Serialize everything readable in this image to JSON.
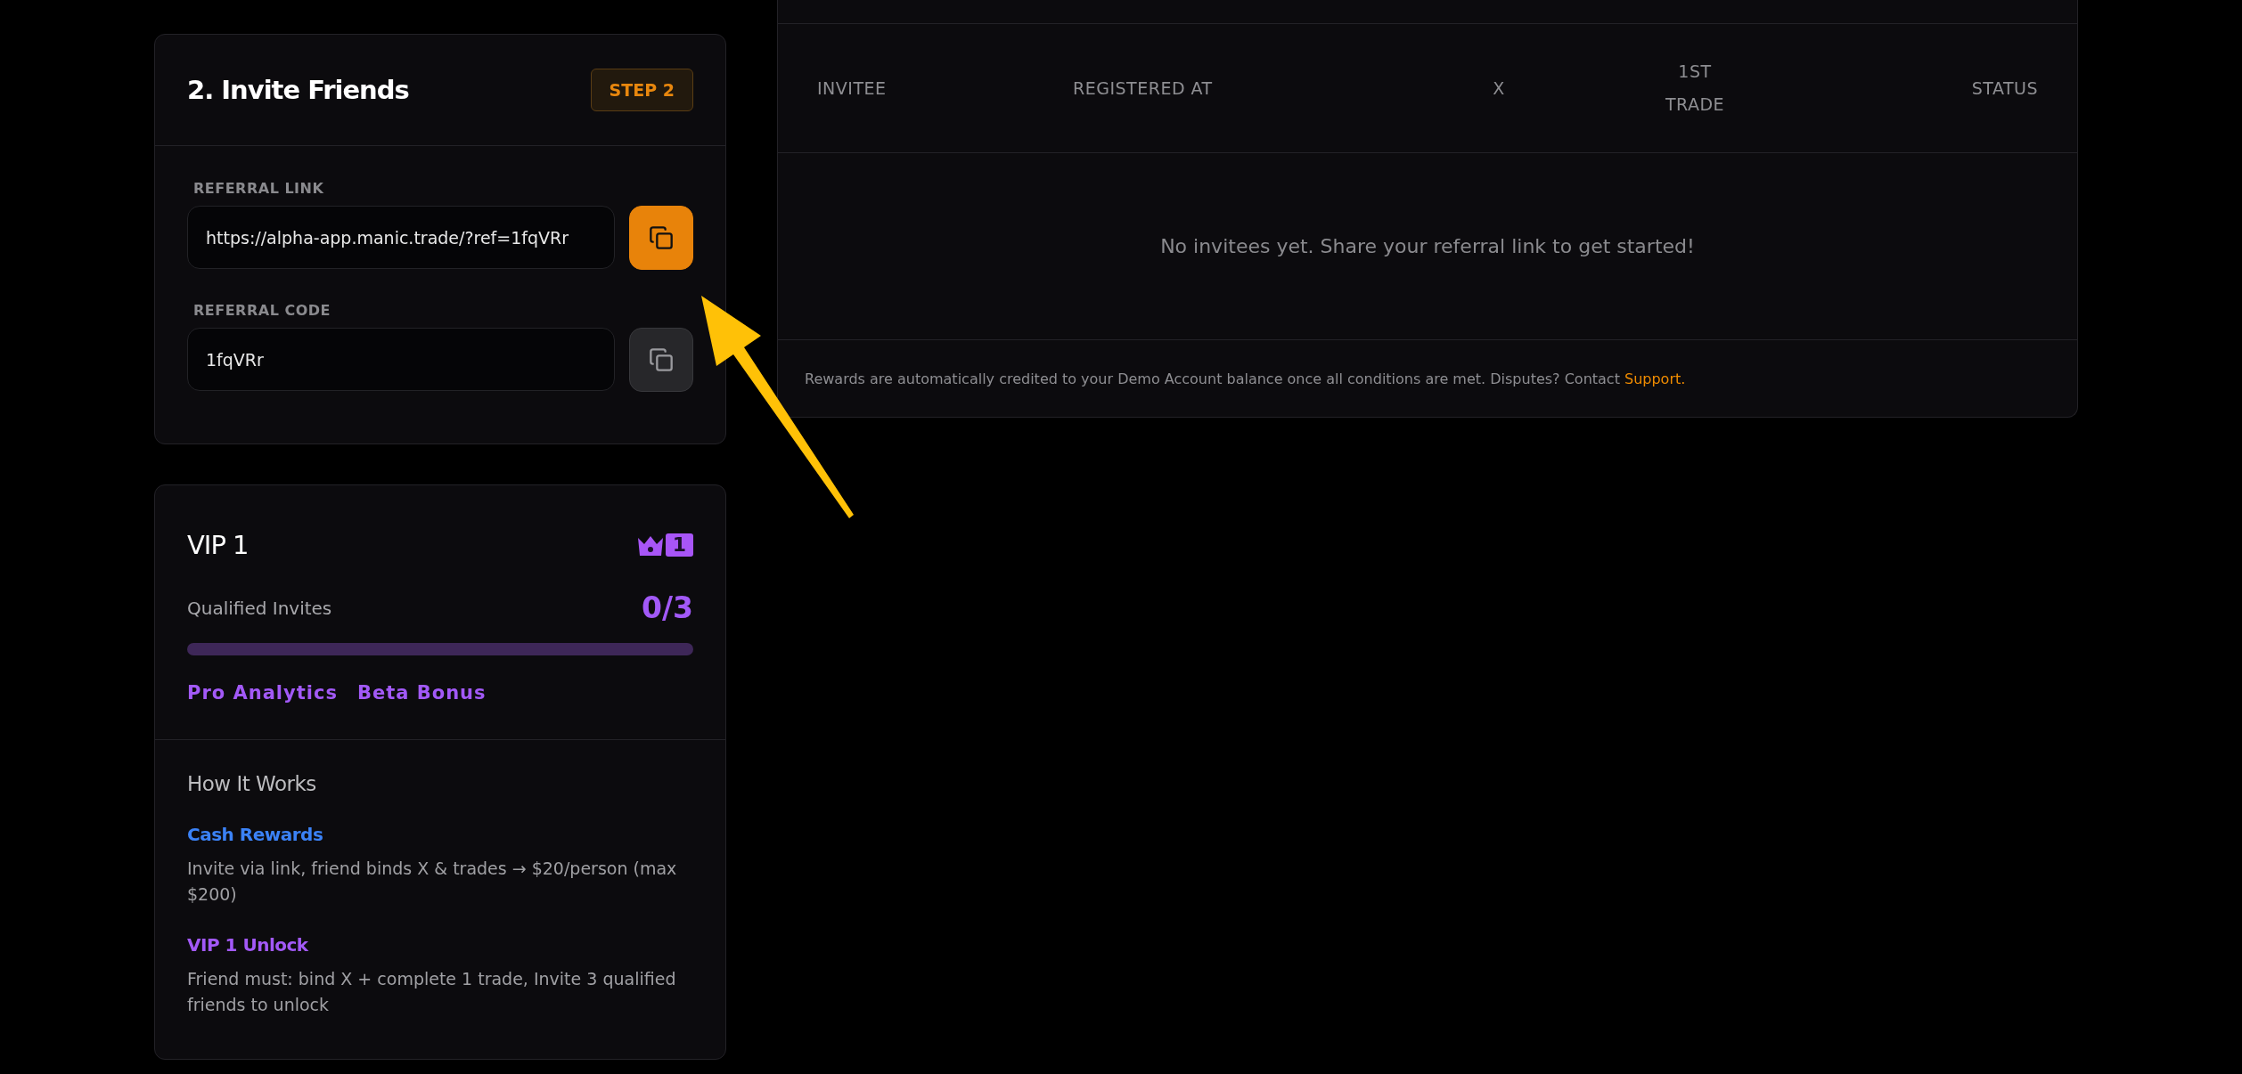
{
  "invite_card": {
    "title": "2. Invite Friends",
    "step_badge": "STEP 2",
    "fields": [
      {
        "label": "REFERRAL LINK",
        "value": "https://alpha-app.manic.trade/?ref=1fqVRr",
        "copy_highlighted": true
      },
      {
        "label": "REFERRAL CODE",
        "value": "1fqVRr",
        "copy_highlighted": false
      }
    ]
  },
  "vip_card": {
    "title": "VIP 1",
    "badge": "1",
    "progress_label": "Qualified Invites",
    "progress_count": "0/3",
    "level": 0,
    "perks": [
      "Pro Analytics",
      "Beta Bonus"
    ],
    "how_it_works": {
      "title": "How It Works",
      "items": [
        {
          "title": "Cash Rewards",
          "text": "Invite via link, friend binds X & trades → $20/person (max $200)",
          "color": "#3b82f6"
        },
        {
          "title": "VIP 1 Unlock",
          "text": "Friend must: bind X + complete 1 trade, Invite 3 qualified friends to unlock",
          "color": "#a259f7"
        }
      ]
    }
  },
  "invitees_table": {
    "columns": [
      "INVITEE",
      "REGISTERED AT",
      "X",
      "1ST TRADE",
      "STATUS"
    ],
    "empty_message": "No invitees yet. Share your referral link to get started!",
    "footer": {
      "text": "Rewards are automatically credited to your Demo Account balance once all conditions are met. Disputes? Contact ",
      "link": "Support."
    }
  },
  "annotation": {
    "kind": "arrow"
  }
}
